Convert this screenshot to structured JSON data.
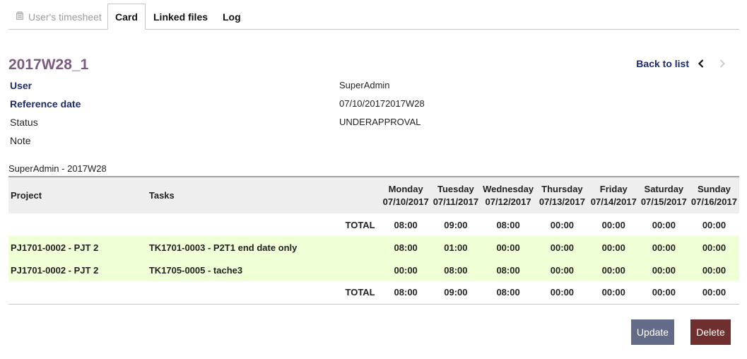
{
  "tabs": [
    {
      "label": "User's timesheet",
      "state": "disabled",
      "icon": "timesheet-icon"
    },
    {
      "label": "Card",
      "state": "active"
    },
    {
      "label": "Linked files",
      "state": "normal"
    },
    {
      "label": "Log",
      "state": "normal"
    }
  ],
  "record": {
    "ref": "2017W28_1",
    "back_label": "Back to list"
  },
  "fields": {
    "user_label": "User",
    "user_value": "SuperAdmin",
    "refdate_label": "Reference date",
    "refdate_value": "07/10/20172017W28",
    "status_label": "Status",
    "status_value": "UNDERAPPROVAL",
    "note_label": "Note",
    "note_value": ""
  },
  "caption": "SuperAdmin - 2017W28",
  "table": {
    "col_project": "Project",
    "col_tasks": "Tasks",
    "days": [
      {
        "name": "Monday",
        "date": "07/10/2017"
      },
      {
        "name": "Tuesday",
        "date": "07/11/2017"
      },
      {
        "name": "Wednesday",
        "date": "07/12/2017"
      },
      {
        "name": "Thursday",
        "date": "07/13/2017"
      },
      {
        "name": "Friday",
        "date": "07/14/2017"
      },
      {
        "name": "Saturday",
        "date": "07/15/2017"
      },
      {
        "name": "Sunday",
        "date": "07/16/2017"
      }
    ],
    "total_label": "TOTAL",
    "totals": [
      "08:00",
      "09:00",
      "08:00",
      "00:00",
      "00:00",
      "00:00",
      "00:00"
    ],
    "rows": [
      {
        "project": "PJ1701-0002 - PJT 2",
        "task": "TK1701-0003 - P2T1 end date only",
        "hours": [
          "08:00",
          "01:00",
          "00:00",
          "00:00",
          "00:00",
          "00:00",
          "00:00"
        ]
      },
      {
        "project": "PJ1701-0002 - PJT 2",
        "task": "TK1705-0005 - tache3",
        "hours": [
          "00:00",
          "08:00",
          "08:00",
          "00:00",
          "00:00",
          "00:00",
          "00:00"
        ]
      }
    ]
  },
  "buttons": {
    "update": "Update",
    "delete": "Delete"
  },
  "colors": {
    "title": "#7b5b82",
    "link": "#1c2a6b",
    "row_highlight": "#efffd6",
    "update_button": "#626c88",
    "delete_button": "#6f2f2f"
  }
}
